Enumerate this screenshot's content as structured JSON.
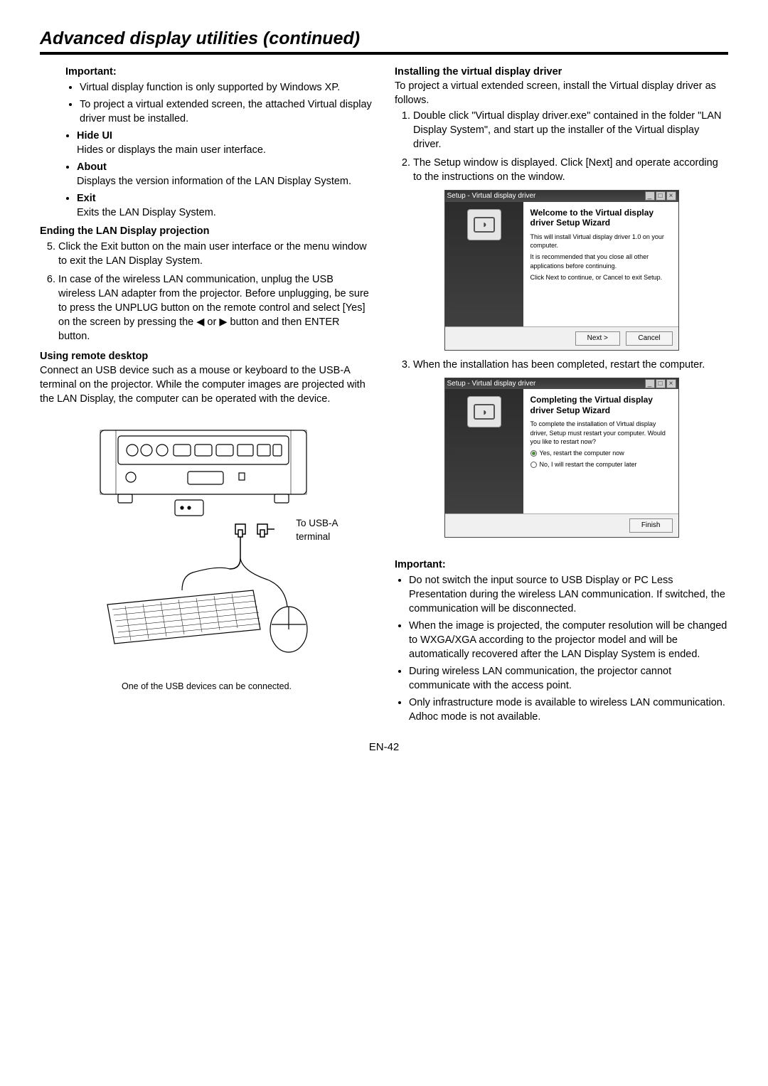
{
  "header": {
    "title": "Advanced display utilities (continued)"
  },
  "left": {
    "important_heading": "Important:",
    "important_items": [
      "Virtual display function is only supported by Windows XP.",
      "To project a virtual extended screen, the attached Virtual display driver must be installed."
    ],
    "menu_items": [
      {
        "label": "Hide UI",
        "desc": "Hides or displays the main user interface."
      },
      {
        "label": "About",
        "desc": "Displays the version information of the  LAN Display System."
      },
      {
        "label": "Exit",
        "desc": "Exits the LAN Display System."
      }
    ],
    "ending_heading": "Ending the LAN Display projection",
    "ending_steps_start": 5,
    "ending_steps": [
      "Click the Exit button on the main user interface or the menu window to exit the LAN Display System.",
      "In case of the wireless LAN communication, unplug the USB wireless LAN adapter from the projector. Before unplugging, be sure to press the UNPLUG button on the remote control and select [Yes] on the screen by pressing the ◀ or ▶ button and then ENTER button."
    ],
    "remote_heading": "Using remote desktop",
    "remote_para": "Connect an USB device such as a mouse or keyboard to the USB-A terminal on the projector. While the computer images are projected with the LAN Display, the computer can be operated with the device.",
    "usb_label_line1": "To USB-A",
    "usb_label_line2": "terminal",
    "diagram_caption": "One of the USB devices can be connected."
  },
  "right": {
    "install_heading": "Installing the virtual display driver",
    "install_para": "To project a virtual extended screen, install the Virtual display driver as follows.",
    "install_steps": [
      "Double click \"Virtual display driver.exe\" contained in the folder \"LAN Display System\", and start up the installer of the Virtual display driver.",
      "The Setup window is displayed. Click [Next] and operate according to the instructions on the window."
    ],
    "wizard1": {
      "titlebar": "Setup - Virtual display driver",
      "heading": "Welcome to the Virtual display driver Setup Wizard",
      "line1": "This will install Virtual display driver 1.0 on your computer.",
      "line2": "It is recommended that you close all other applications before continuing.",
      "line3": "Click Next to continue, or Cancel to exit Setup.",
      "next_btn": "Next >",
      "cancel_btn": "Cancel"
    },
    "step3": "When the installation has been completed, restart the computer.",
    "wizard2": {
      "titlebar": "Setup - Virtual display driver",
      "heading": "Completing the Virtual display driver Setup Wizard",
      "line1": "To complete the installation of Virtual display driver, Setup must restart your computer. Would you like to restart now?",
      "radio1": "Yes, restart the computer now",
      "radio2": "No, I will restart the computer later",
      "finish_btn": "Finish"
    },
    "important_heading": "Important:",
    "important_items": [
      "Do not switch the input source to USB Display or PC Less Presentation during the wireless LAN communication. If switched, the communication will be disconnected.",
      "When the image is projected, the computer resolution will be changed to WXGA/XGA according to the projector model and will be automatically recovered after the LAN Display System is ended.",
      "During wireless LAN communication, the projector cannot communicate with the access point.",
      "Only infrastructure mode is available to wireless LAN communication. Adhoc mode is not available."
    ]
  },
  "footer": {
    "page_number": "EN-42"
  }
}
